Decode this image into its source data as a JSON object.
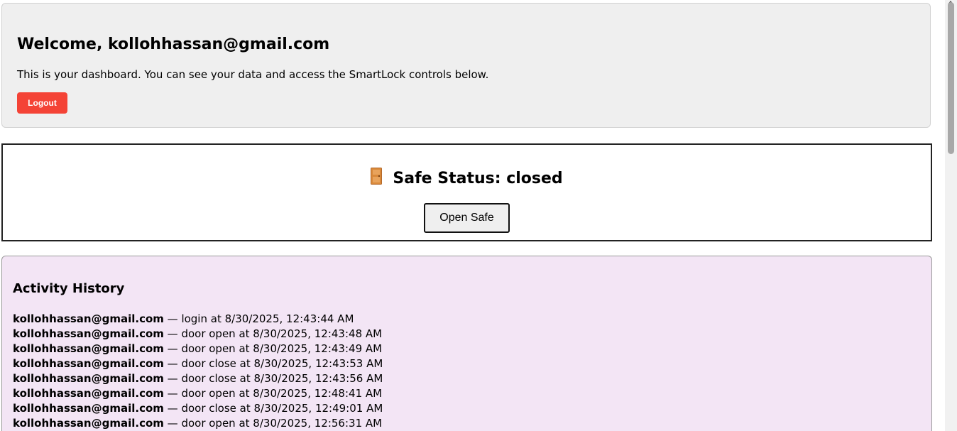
{
  "header": {
    "welcome_title": "Welcome, kollohhassan@gmail.com",
    "description": "This is your dashboard. You can see your data and access the SmartLock controls below.",
    "logout_label": "Logout"
  },
  "safe": {
    "status_text": "Safe Status: closed",
    "icon": "door-icon",
    "open_button_label": "Open Safe"
  },
  "activity": {
    "title": "Activity History",
    "entries": [
      {
        "user": "kollohhassan@gmail.com",
        "detail": " — login at 8/30/2025, 12:43:44 AM"
      },
      {
        "user": "kollohhassan@gmail.com",
        "detail": " — door open at 8/30/2025, 12:43:48 AM"
      },
      {
        "user": "kollohhassan@gmail.com",
        "detail": " — door open at 8/30/2025, 12:43:49 AM"
      },
      {
        "user": "kollohhassan@gmail.com",
        "detail": " — door close at 8/30/2025, 12:43:53 AM"
      },
      {
        "user": "kollohhassan@gmail.com",
        "detail": " — door close at 8/30/2025, 12:43:56 AM"
      },
      {
        "user": "kollohhassan@gmail.com",
        "detail": " — door open at 8/30/2025, 12:48:41 AM"
      },
      {
        "user": "kollohhassan@gmail.com",
        "detail": " — door close at 8/30/2025, 12:49:01 AM"
      },
      {
        "user": "kollohhassan@gmail.com",
        "detail": " — door open at 8/30/2025, 12:56:31 AM"
      }
    ]
  },
  "colors": {
    "welcome_bg": "#efefef",
    "logout_bg": "#f44336",
    "activity_bg": "#f3e5f5",
    "door_icon": "#d9893a"
  }
}
